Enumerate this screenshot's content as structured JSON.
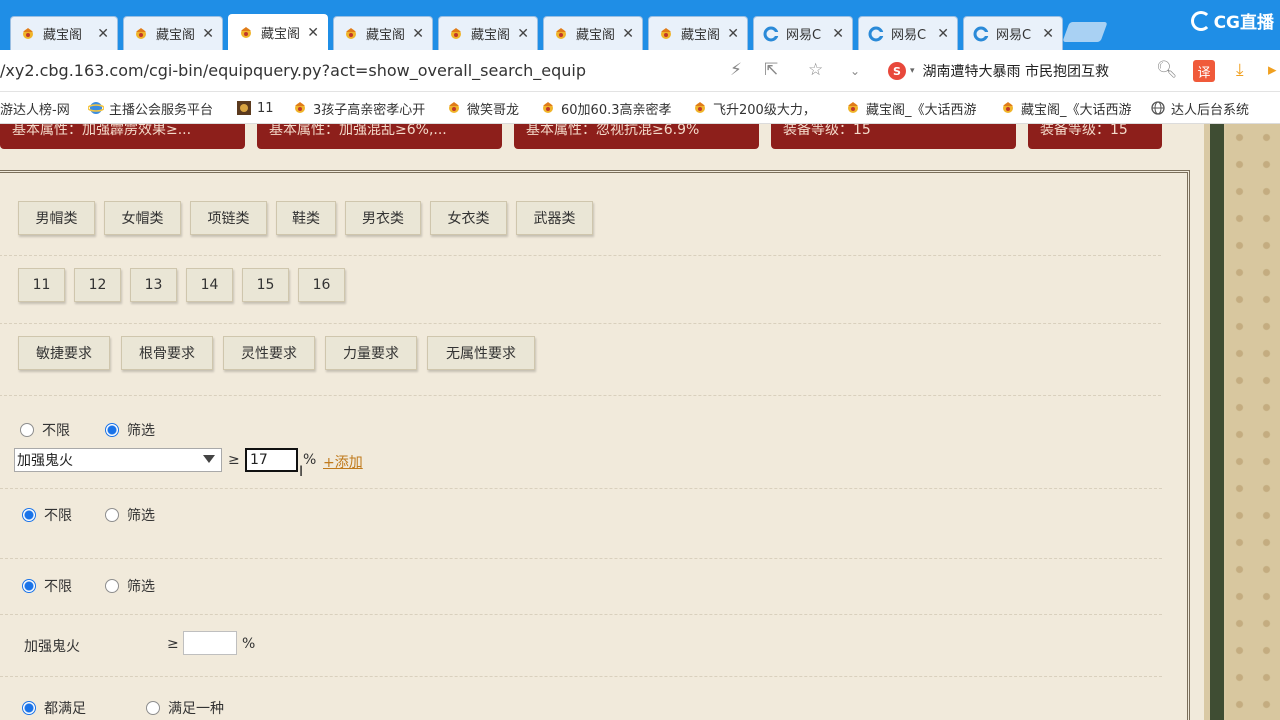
{
  "tabs": [
    {
      "label": "藏宝阁",
      "icon": "dragon-icon",
      "active": false
    },
    {
      "label": "藏宝阁",
      "icon": "dragon-icon",
      "active": false
    },
    {
      "label": "藏宝阁",
      "icon": "dragon-icon",
      "active": true
    },
    {
      "label": "藏宝阁",
      "icon": "dragon-icon",
      "active": false
    },
    {
      "label": "藏宝阁",
      "icon": "dragon-icon",
      "active": false
    },
    {
      "label": "藏宝阁",
      "icon": "dragon-icon",
      "active": false
    },
    {
      "label": "藏宝阁",
      "icon": "dragon-icon",
      "active": false
    },
    {
      "label": "网易C",
      "icon": "netease-icon",
      "active": false
    },
    {
      "label": "网易C",
      "icon": "netease-icon",
      "active": false
    },
    {
      "label": "网易C",
      "icon": "netease-icon",
      "active": false
    }
  ],
  "brand": {
    "name": "CG直播"
  },
  "address": {
    "url": "/xy2.cbg.163.com/cgi-bin/equipquery.py?act=show_overall_search_equip",
    "news": "湖南遭特大暴雨 市民抱团互救",
    "news_logo": "S",
    "translate_label": "译"
  },
  "bookmarks": [
    {
      "label": "游达人榜-网",
      "icon": "none"
    },
    {
      "label": "主播公会服务平台",
      "icon": "ie-icon"
    },
    {
      "label": "11",
      "icon": "game-icon"
    },
    {
      "label": "3孩子高亲密孝心开",
      "icon": "dragon-icon"
    },
    {
      "label": "微笑哥龙",
      "icon": "dragon-icon"
    },
    {
      "label": "60加60.3高亲密孝",
      "icon": "dragon-icon"
    },
    {
      "label": "飞升200级大力，",
      "icon": "dragon-icon"
    },
    {
      "label": "藏宝阁_《大话西游",
      "icon": "dragon-icon"
    },
    {
      "label": "藏宝阁_《大话西游",
      "icon": "dragon-icon"
    },
    {
      "label": "达人后台系统",
      "icon": "globe-icon"
    }
  ],
  "attr_tags": [
    "基本属性：加强霹雳效果≥...",
    "基本属性：加强混乱≥6%,...",
    "基本属性：忽视抗混≥6.9%",
    "装备等级：15",
    "装备等级：15"
  ],
  "categories": [
    "男帽类",
    "女帽类",
    "项链类",
    "鞋类",
    "男衣类",
    "女衣类",
    "武器类"
  ],
  "levels": [
    "11",
    "12",
    "13",
    "14",
    "15",
    "16"
  ],
  "requirements": [
    "敏捷要求",
    "根骨要求",
    "灵性要求",
    "力量要求",
    "无属性要求"
  ],
  "filter1": {
    "unlimited": "不限",
    "filter": "筛选",
    "selected": "filter",
    "attribute": "加强鬼火",
    "ge": "≥",
    "value": "17",
    "unit": "%",
    "add": "+添加"
  },
  "filter2": {
    "unlimited": "不限",
    "filter": "筛选",
    "selected": "unlimited"
  },
  "filter3": {
    "unlimited": "不限",
    "filter": "筛选",
    "selected": "unlimited"
  },
  "row4": {
    "label": "加强鬼火",
    "ge": "≥",
    "value": "",
    "unit": "%"
  },
  "match": {
    "all": "都满足",
    "any": "满足一种",
    "selected": "all"
  }
}
